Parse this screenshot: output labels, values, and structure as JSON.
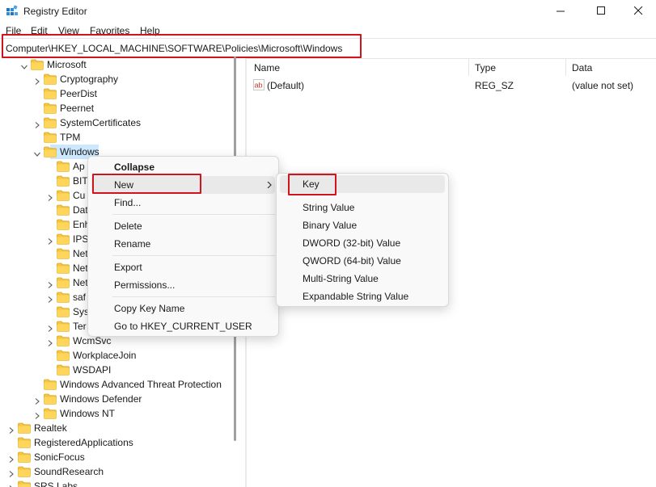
{
  "window": {
    "title": "Registry Editor",
    "icons": [
      "registry-editor-icon",
      "minimize-icon",
      "maximize-icon",
      "close-icon"
    ]
  },
  "menubar": {
    "items": [
      "File",
      "Edit",
      "View",
      "Favorites",
      "Help"
    ]
  },
  "address": {
    "path": "Computer\\HKEY_LOCAL_MACHINE\\SOFTWARE\\Policies\\Microsoft\\Windows"
  },
  "tree": {
    "items": [
      {
        "label": "Microsoft",
        "expanded": true
      },
      {
        "label": "Cryptography",
        "expandable": true
      },
      {
        "label": "PeerDist"
      },
      {
        "label": "Peernet"
      },
      {
        "label": "SystemCertificates",
        "expandable": true
      },
      {
        "label": "TPM"
      },
      {
        "label": "Windows",
        "expanded": true,
        "selected": true
      },
      {
        "label": "Ap"
      },
      {
        "label": "BIT"
      },
      {
        "label": "Cu",
        "expandable": true
      },
      {
        "label": "Dat"
      },
      {
        "label": "Enh"
      },
      {
        "label": "IPS",
        "expandable": true
      },
      {
        "label": "Net"
      },
      {
        "label": "Net"
      },
      {
        "label": "Net",
        "expandable": true
      },
      {
        "label": "saf",
        "expandable": true
      },
      {
        "label": "Sys"
      },
      {
        "label": "Ter",
        "expandable": true
      },
      {
        "label": "WcmSvc",
        "expandable": true
      },
      {
        "label": "WorkplaceJoin"
      },
      {
        "label": "WSDAPI"
      },
      {
        "label": "Windows Advanced Threat Protection"
      },
      {
        "label": "Windows Defender",
        "expandable": true
      },
      {
        "label": "Windows NT",
        "expandable": true
      },
      {
        "label": "Realtek",
        "expandable": true
      },
      {
        "label": "RegisteredApplications"
      },
      {
        "label": "SonicFocus",
        "expandable": true
      },
      {
        "label": "SoundResearch",
        "expandable": true
      },
      {
        "label": "SRS Labs",
        "expandable": true
      }
    ]
  },
  "list": {
    "columns": [
      "Name",
      "Type",
      "Data"
    ],
    "rows": [
      {
        "name": "(Default)",
        "type": "REG_SZ",
        "data": "(value not set)"
      }
    ]
  },
  "context_menu": {
    "items": [
      "Collapse",
      "New",
      "Find...",
      "Delete",
      "Rename",
      "Export",
      "Permissions...",
      "Copy Key Name",
      "Go to HKEY_CURRENT_USER"
    ]
  },
  "new_submenu": {
    "items": [
      "Key",
      "String Value",
      "Binary Value",
      "DWORD (32-bit) Value",
      "QWORD (64-bit) Value",
      "Multi-String Value",
      "Expandable String Value"
    ]
  },
  "colors": {
    "highlight_box": "#d0131c",
    "folder": "#f5c542",
    "selection": "#cce8ff"
  }
}
